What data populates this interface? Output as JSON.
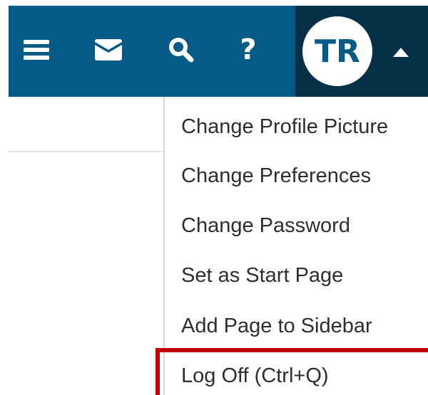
{
  "header": {
    "icons": {
      "menu": "menu-icon",
      "mail": "mail-icon",
      "search": "search-icon",
      "help": "help-icon",
      "caret": "caret-up-icon"
    },
    "help_glyph": "?",
    "user": {
      "initials": "TR"
    },
    "colors": {
      "bar": "#065a86",
      "user_block": "#063047"
    }
  },
  "user_menu": {
    "items": [
      {
        "label": "Change Profile Picture"
      },
      {
        "label": "Change Preferences"
      },
      {
        "label": "Change Password"
      },
      {
        "label": "Set as Start Page"
      },
      {
        "label": "Add Page to Sidebar"
      },
      {
        "label": "Log Off (Ctrl+Q)"
      }
    ],
    "highlight_color": "#c00000"
  }
}
